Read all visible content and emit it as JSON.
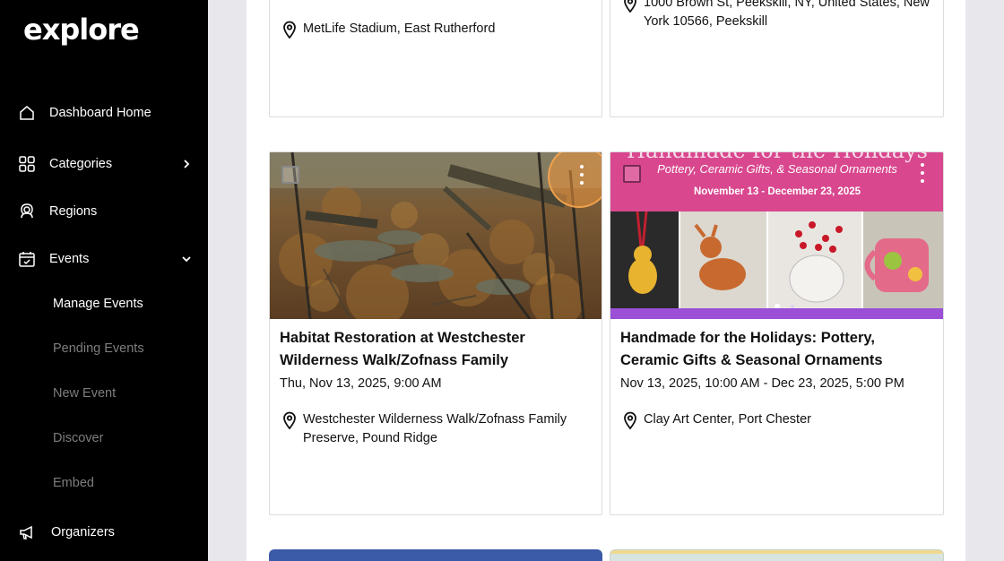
{
  "sidebar": {
    "logo": "explore",
    "items": [
      {
        "label": "Dashboard Home",
        "icon": "home-icon"
      },
      {
        "label": "Categories",
        "icon": "grid-icon"
      },
      {
        "label": "Regions",
        "icon": "map-user-icon"
      },
      {
        "label": "Events",
        "icon": "calendar-icon"
      },
      {
        "label": "Organizers",
        "icon": "megaphone-icon"
      }
    ],
    "events_sub": [
      {
        "label": "Manage Events",
        "active": true
      },
      {
        "label": "Pending Events",
        "active": false
      },
      {
        "label": "New Event",
        "active": false
      },
      {
        "label": "Discover",
        "active": false
      },
      {
        "label": "Embed",
        "active": false
      }
    ]
  },
  "cards_top": [
    {
      "location": "MetLife Stadium, East Rutherford"
    },
    {
      "location_line1": "1000 Brown St, Peekskill, NY, United States, New",
      "location_line2": "York 10566, Peekskill"
    }
  ],
  "cards": [
    {
      "title": "Habitat Restoration at Westchester Wilderness Walk/Zofnass Family",
      "date": "Thu, Nov 13, 2025, 9:00 AM",
      "location": "Westchester Wilderness Walk/Zofnass Family Preserve, Pound Ridge"
    },
    {
      "title": "Handmade for the Holidays: Pottery, Ceramic Gifts & Seasonal Ornaments",
      "date": "Nov 13, 2025, 10:00 AM - Dec 23, 2025, 5:00 PM",
      "location": "Clay Art Center, Port Chester",
      "banner_heading": "Handmade for the Holidays",
      "banner_sub": "Pottery, Ceramic Gifts, & Seasonal Ornaments",
      "banner_dates": "November 13 - December 23, 2025"
    }
  ],
  "colors": {
    "sidebar_bg": "#000000",
    "banner_pink": "#d9478e",
    "banner_purple": "#9b4fd6",
    "highlight_orange": "#f0a040"
  }
}
